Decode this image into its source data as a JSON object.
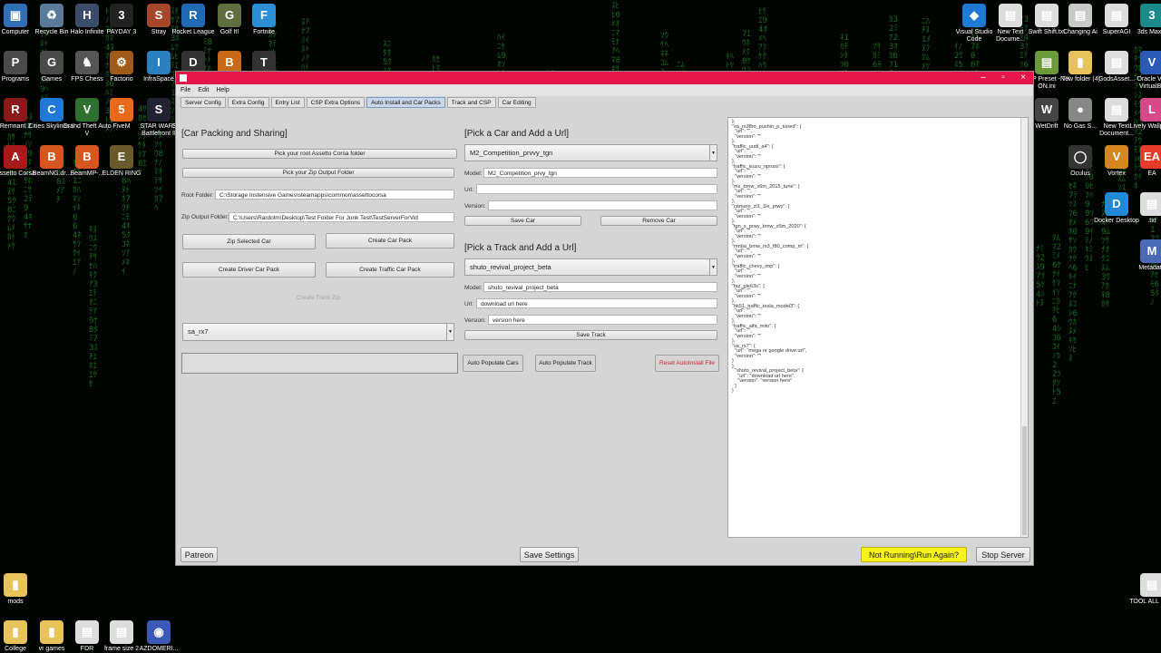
{
  "desktop": {
    "icons_left": [
      {
        "label": "Computer",
        "glyph": "▣",
        "color": "#2f6fb5"
      },
      {
        "label": "Recycle Bin",
        "glyph": "♻",
        "color": "#5a7a9a"
      },
      {
        "label": "Halo Infinite",
        "glyph": "H",
        "color": "#3b4b6b"
      },
      {
        "label": "PAYDAY 3",
        "glyph": "3",
        "color": "#222"
      },
      {
        "label": "Stray",
        "glyph": "S",
        "color": "#a4472a"
      },
      {
        "label": "Rocket League",
        "glyph": "R",
        "color": "#1f6ab3"
      },
      {
        "label": "Golf It!",
        "glyph": "G",
        "color": "#5f6f3f"
      },
      {
        "label": "Fortnite",
        "glyph": "F",
        "color": "#2a8fd6"
      },
      {
        "label": "Programs",
        "glyph": "P",
        "color": "#4a4a4a"
      },
      {
        "label": "Games",
        "glyph": "G",
        "color": "#4a4a4a"
      },
      {
        "label": "FPS Chess",
        "glyph": "♞",
        "color": "#555"
      },
      {
        "label": "Factorio",
        "glyph": "⚙",
        "color": "#a05a1a"
      },
      {
        "label": "InfraSpace",
        "glyph": "I",
        "color": "#2a7fbf"
      },
      {
        "label": "Destiny 2",
        "glyph": "D",
        "color": "#333"
      },
      {
        "label": "Battlefield™ 2042",
        "glyph": "B",
        "color": "#c66a1a"
      },
      {
        "label": "Tom Clancy's Rainbow Si...",
        "glyph": "T",
        "color": "#333"
      },
      {
        "label": "Remnant 2",
        "glyph": "R",
        "color": "#8a1a1a"
      },
      {
        "label": "Cities Skylines II",
        "glyph": "C",
        "color": "#1f7ad6"
      },
      {
        "label": "Grand Theft Auto V",
        "glyph": "V",
        "color": "#2f6f2f"
      },
      {
        "label": "FiveM",
        "glyph": "5",
        "color": "#e86a1a"
      },
      {
        "label": "STAR WARS Battlefront II",
        "glyph": "S",
        "color": "#223"
      },
      {
        "label": "Stick Fight The Game",
        "glyph": "✦",
        "color": "#b82222"
      },
      {
        "label": "Clone Hero",
        "glyph": "CH",
        "color": "#222"
      },
      {
        "label": "Gang Beasts",
        "glyph": "G",
        "color": "#d6a81f"
      },
      {
        "label": "Assetto Corsa",
        "glyph": "A",
        "color": "#a61a1a"
      },
      {
        "label": "BeamNG.dr...",
        "glyph": "B",
        "color": "#d6561f"
      },
      {
        "label": "BeamMP-...",
        "glyph": "B",
        "color": "#d6561f"
      },
      {
        "label": "ELDEN RING",
        "glyph": "E",
        "color": "#6a5a2a"
      }
    ],
    "icons_right": [
      {
        "label": "Visual Studio Code",
        "glyph": "◆",
        "color": "#1f7ad6"
      },
      {
        "label": "New Text Docume...",
        "glyph": "▤",
        "color": "#ddd"
      },
      {
        "label": "Swift Shift.txt",
        "glyph": "▤",
        "color": "#ddd"
      },
      {
        "label": "Changing Ai",
        "glyph": "▤",
        "color": "#c9c9c9"
      },
      {
        "label": "SuperAGI",
        "glyph": "▤",
        "color": "#ddd"
      },
      {
        "label": "3ds Max 2",
        "glyph": "3",
        "color": "#1a8a8a"
      },
      {
        "label": "CSP Preset - TX ON.ini",
        "glyph": "▤",
        "color": "#6a9a3a"
      },
      {
        "label": "New folder (4)",
        "glyph": "▮",
        "color": "#e8c25a"
      },
      {
        "label": "GodsAsset...",
        "glyph": "▤",
        "color": "#ddd"
      },
      {
        "label": "Oracle VM VirtualBo",
        "glyph": "V",
        "color": "#2a5ab5"
      },
      {
        "label": "WetDrift",
        "glyph": "W",
        "color": "#444"
      },
      {
        "label": "No Gas S...",
        "glyph": "●",
        "color": "#888"
      },
      {
        "label": "New Text Document...",
        "glyph": "▤",
        "color": "#ddd"
      },
      {
        "label": "Lively Wallpape",
        "glyph": "L",
        "color": "#d64a8a"
      },
      {
        "label": "Oculus",
        "glyph": "◯",
        "color": "#333"
      },
      {
        "label": "Vortex",
        "glyph": "V",
        "color": "#d6861f"
      },
      {
        "label": "EA",
        "glyph": "EA",
        "color": "#e63a2a"
      },
      {
        "label": "Docker Desktop",
        "glyph": "D",
        "color": "#1f8ad6"
      },
      {
        "label": ".txt",
        "glyph": "▤",
        "color": "#ddd"
      },
      {
        "label": "Metadata",
        "glyph": "M",
        "color": "#4a6ab5"
      }
    ],
    "icons_bottom": [
      {
        "label": "mods",
        "glyph": "▮",
        "color": "#e8c25a"
      },
      {
        "label": "College",
        "glyph": "▮",
        "color": "#e8c25a"
      },
      {
        "label": "vr games",
        "glyph": "▮",
        "color": "#e8c25a"
      },
      {
        "label": "FDR",
        "glyph": "▤",
        "color": "#ddd"
      },
      {
        "label": "frame size 2",
        "glyph": "▤",
        "color": "#ddd"
      },
      {
        "label": "AZDOMERI...",
        "glyph": "◉",
        "color": "#3a5ab5"
      },
      {
        "label": "TOOL ALL ONE",
        "glyph": "▤",
        "color": "#ddd"
      }
    ]
  },
  "window": {
    "menu": [
      "File",
      "Edit",
      "Help"
    ],
    "tabs": [
      "Server Config",
      "Extra Config",
      "Entry List",
      "CSP Extra Options",
      "Auto Install and Car Packs",
      "Track and CSP",
      "Car Editing"
    ],
    "active_tab": 4,
    "left": {
      "heading": "[Car Packing and Sharing]",
      "pick_root_btn": "Pick your root Assetto Corsa folder",
      "pick_zip_btn": "Pick your Zip Output Folder",
      "root_label": "Root Folder:",
      "root_value": "C:\\Storage Instensive Games\\steamapps\\common\\assettocorsa",
      "zip_label": "Zip Output Folder:",
      "zip_value": "C:\\Users\\Rardolm\\Desktop\\Test Folder For Junk Test\\TestServerForVid",
      "zip_selected_btn": "Zip Selected Car",
      "create_car_pack_btn": "Create Car Pack",
      "create_driver_btn": "Create Driver Car Pack",
      "create_traffic_btn": "Create Traffic Car Pack",
      "create_track_zip_btn": "Create Track Zip",
      "car_combo": "sa_rx7",
      "auto_cars_btn": "Auto Populate Cars",
      "auto_track_btn": "Auto Populate Track",
      "reset_btn": "Reset AutoInstall File"
    },
    "middle": {
      "car_heading": "[Pick a Car and Add a Url]",
      "car_combo": "M2_Competition_prvvy_tgn",
      "model_label": "Model:",
      "car_model": "M2_Competition_prvy_tgn",
      "url_label": "Url:",
      "car_url": "",
      "version_label": "Version:",
      "car_version": "",
      "save_car_btn": "Save Car",
      "remove_car_btn": "Remove Car",
      "track_heading": "[Pick a Track and Add a Url]",
      "track_combo": "shuto_revival_project_beta",
      "track_model": "shuto_revival_project_beta",
      "track_url": "download url here",
      "track_version": "version here",
      "save_track_btn": "Save Track"
    },
    "json_text": "},\n\"sa_rs3fbo_pushin_p_tuned\": {\n  \"url\": \"\",\n  \"version\": \"\"\n},\n\"traffic_uudi_a4\": {\n  \"url\": \"\",\n  \"version\": \"\"\n},\n\"traffic_isuzu_npruss\": {\n  \"url\": \"\",\n  \"version\": \"\"\n},\n\"ms_bmw_x6m_2015_tune\": {\n  \"url\": \"\",\n  \"version\": \"\"\n},\n\"camaro_zl1_1le_prwy\": {\n  \"url\": \"\",\n  \"version\": \"\"\n},\n\"tgn_x_prwy_bmw_x5m_2020\": {\n  \"url\": \"\",\n  \"version\": \"\"\n},\n\"mnba_bmw_m3_f80_comp_m\": {\n  \"url\": \"\",\n  \"version\": \"\"\n},\n\"traffic_chevy_imp\": {\n  \"url\": \"\",\n  \"version\": \"\"\n},\n\"faz_gle63s\": {\n  \"url\": \"\",\n  \"version\": \"\"\n},\n\"hk51_traffic_tesla_model3\": {\n  \"url\": \"\",\n  \"version\": \"\"\n},\n\"traffic_alfa_mito\": {\n  \"url\": \"\",\n  \"version\": \"\"\n},\n\"sa_rx7\": {\n  \"url\": \"mega or google drive url\",\n  \"version\": \"\"\n}\n},\n  \"shuto_revival_project_beta\": {\n    \"url\": \"download url here\",\n    \"version\": \"version here\"\n  }\n}",
    "bottom": {
      "patreon_btn": "Patreon",
      "save_settings_btn": "Save Settings",
      "run_btn": "Not Running\\Run Again?",
      "stop_btn": "Stop Server"
    }
  },
  "colors": {
    "titlebar": "#e5174a",
    "run_button": "#f6f21a",
    "reset_text": "#d0203a",
    "rain": "#1f8f2c"
  }
}
